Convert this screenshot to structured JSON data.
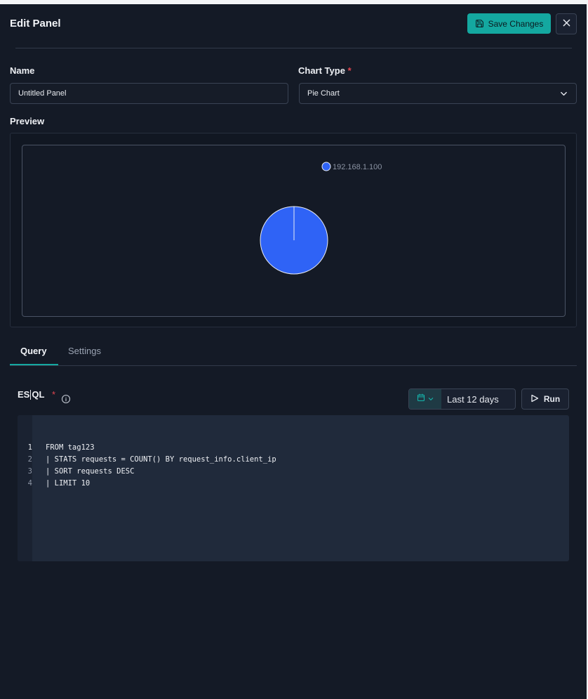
{
  "header": {
    "title": "Edit Panel",
    "save_label": "Save Changes",
    "close_icon": "close-icon"
  },
  "form": {
    "name_label": "Name",
    "name_value": "Untitled Panel",
    "chart_type_label": "Chart Type",
    "required_mark": "*",
    "chart_type_value": "Pie Chart",
    "preview_label": "Preview"
  },
  "chart_data": {
    "type": "pie",
    "labels": [
      "192.168.1.100"
    ],
    "values": [
      1
    ],
    "colors": [
      "#2f63f6"
    ],
    "legend_position": "top"
  },
  "tabs": [
    {
      "label": "Query",
      "active": true
    },
    {
      "label": "Settings",
      "active": false
    }
  ],
  "query": {
    "label_left": "ES",
    "label_right": "QL",
    "required_mark": "*",
    "time_range": "Last 12 days",
    "run_label": "Run",
    "lines": [
      {
        "number": "1",
        "code": "FROM tag123"
      },
      {
        "number": "2",
        "code": "| STATS requests = COUNT() BY request_info.client_ip"
      },
      {
        "number": "3",
        "code": "| SORT requests DESC"
      },
      {
        "number": "4",
        "code": "| LIMIT 10"
      }
    ]
  },
  "colors": {
    "accent": "#14a8a0",
    "background": "#141a26",
    "required": "#e0454f",
    "pie_slice": "#2f63f6"
  }
}
